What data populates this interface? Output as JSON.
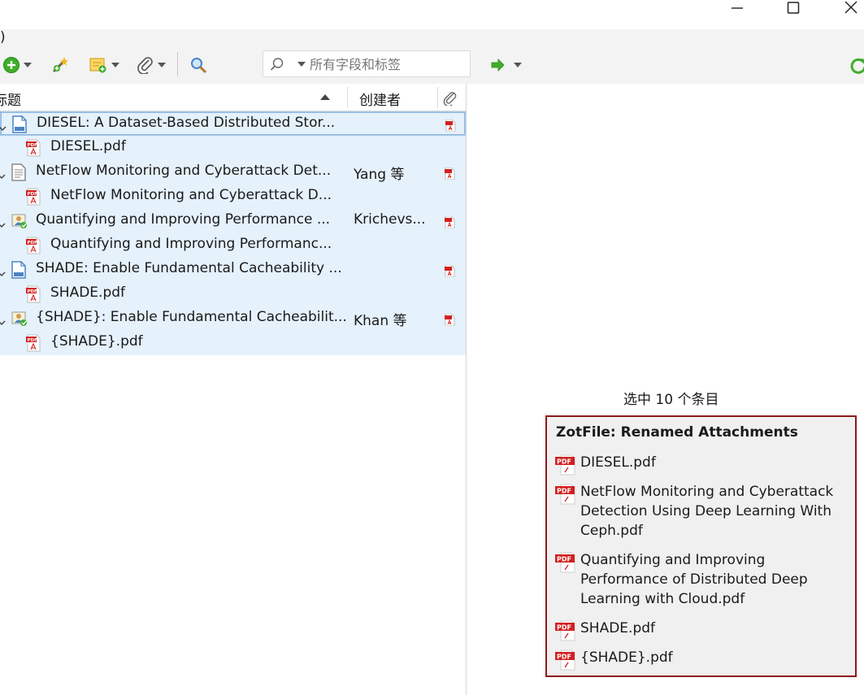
{
  "window": {
    "caption": ")",
    "controls": {
      "minimize": "minimize-icon",
      "maximize": "maximize-icon",
      "close": "close-icon"
    }
  },
  "toolbar": {
    "buttons": [
      {
        "name": "new-item-button",
        "icon": "green-plus-circle-icon",
        "dropdown": true
      },
      {
        "name": "add-by-identifier-button",
        "icon": "magic-wand-icon",
        "dropdown": false
      },
      {
        "name": "new-note-button",
        "icon": "note-icon",
        "dropdown": true
      },
      {
        "name": "add-attachment-button",
        "icon": "paperclip-icon",
        "dropdown": true
      },
      {
        "name": "advanced-search-button",
        "icon": "magnifier-icon",
        "dropdown": false
      }
    ],
    "search": {
      "placeholder": "所有字段和标签",
      "value": ""
    },
    "locate": {
      "icon": "green-arrow-icon"
    },
    "sync": {
      "icon": "sync-icon"
    }
  },
  "items_list": {
    "columns": {
      "title": "标题",
      "creator": "创建者",
      "attachments_icon": "paperclip-icon"
    },
    "sort": "title-ascending",
    "rows": [
      {
        "kind": "item",
        "icon": "document-icon",
        "title": "DIESEL: A Dataset-Based Distributed Stor...",
        "creator": "",
        "has_pdf": true
      },
      {
        "kind": "attachment",
        "icon": "pdf-icon",
        "title": "DIESEL.pdf"
      },
      {
        "kind": "item",
        "icon": "text-document-icon",
        "title": "NetFlow Monitoring and Cyberattack Det...",
        "creator": "Yang 等",
        "has_pdf": true
      },
      {
        "kind": "attachment",
        "icon": "pdf-icon",
        "title": "NetFlow Monitoring and Cyberattack D..."
      },
      {
        "kind": "item",
        "icon": "presentation-icon",
        "title": "Quantifying and Improving Performance ...",
        "creator": "Krichevs...",
        "has_pdf": true
      },
      {
        "kind": "attachment",
        "icon": "pdf-icon",
        "title": "Quantifying and Improving Performanc..."
      },
      {
        "kind": "item",
        "icon": "document-icon",
        "title": "SHADE: Enable Fundamental Cacheability ...",
        "creator": "",
        "has_pdf": true
      },
      {
        "kind": "attachment",
        "icon": "pdf-icon",
        "title": "SHADE.pdf"
      },
      {
        "kind": "item",
        "icon": "presentation-icon",
        "title": "{SHADE}: Enable Fundamental Cacheabilit...",
        "creator": "Khan 等",
        "has_pdf": true
      },
      {
        "kind": "attachment",
        "icon": "pdf-icon",
        "title": "{SHADE}.pdf"
      }
    ]
  },
  "item_pane": {
    "selection_text": "选中 10 个条目"
  },
  "notification": {
    "title": "ZotFile: Renamed Attachments",
    "items": [
      "DIESEL.pdf",
      "NetFlow Monitoring and Cyberattack Detection Using Deep Learning With Ceph.pdf",
      "Quantifying and Improving Performance of Distributed Deep Learning with Cloud.pdf",
      "SHADE.pdf",
      "{SHADE}.pdf"
    ],
    "border_color": "#8b1a1a"
  },
  "colors": {
    "selection": "#e5f1fb",
    "pdf_red": "#d32020",
    "accent_green": "#3fae2a"
  }
}
